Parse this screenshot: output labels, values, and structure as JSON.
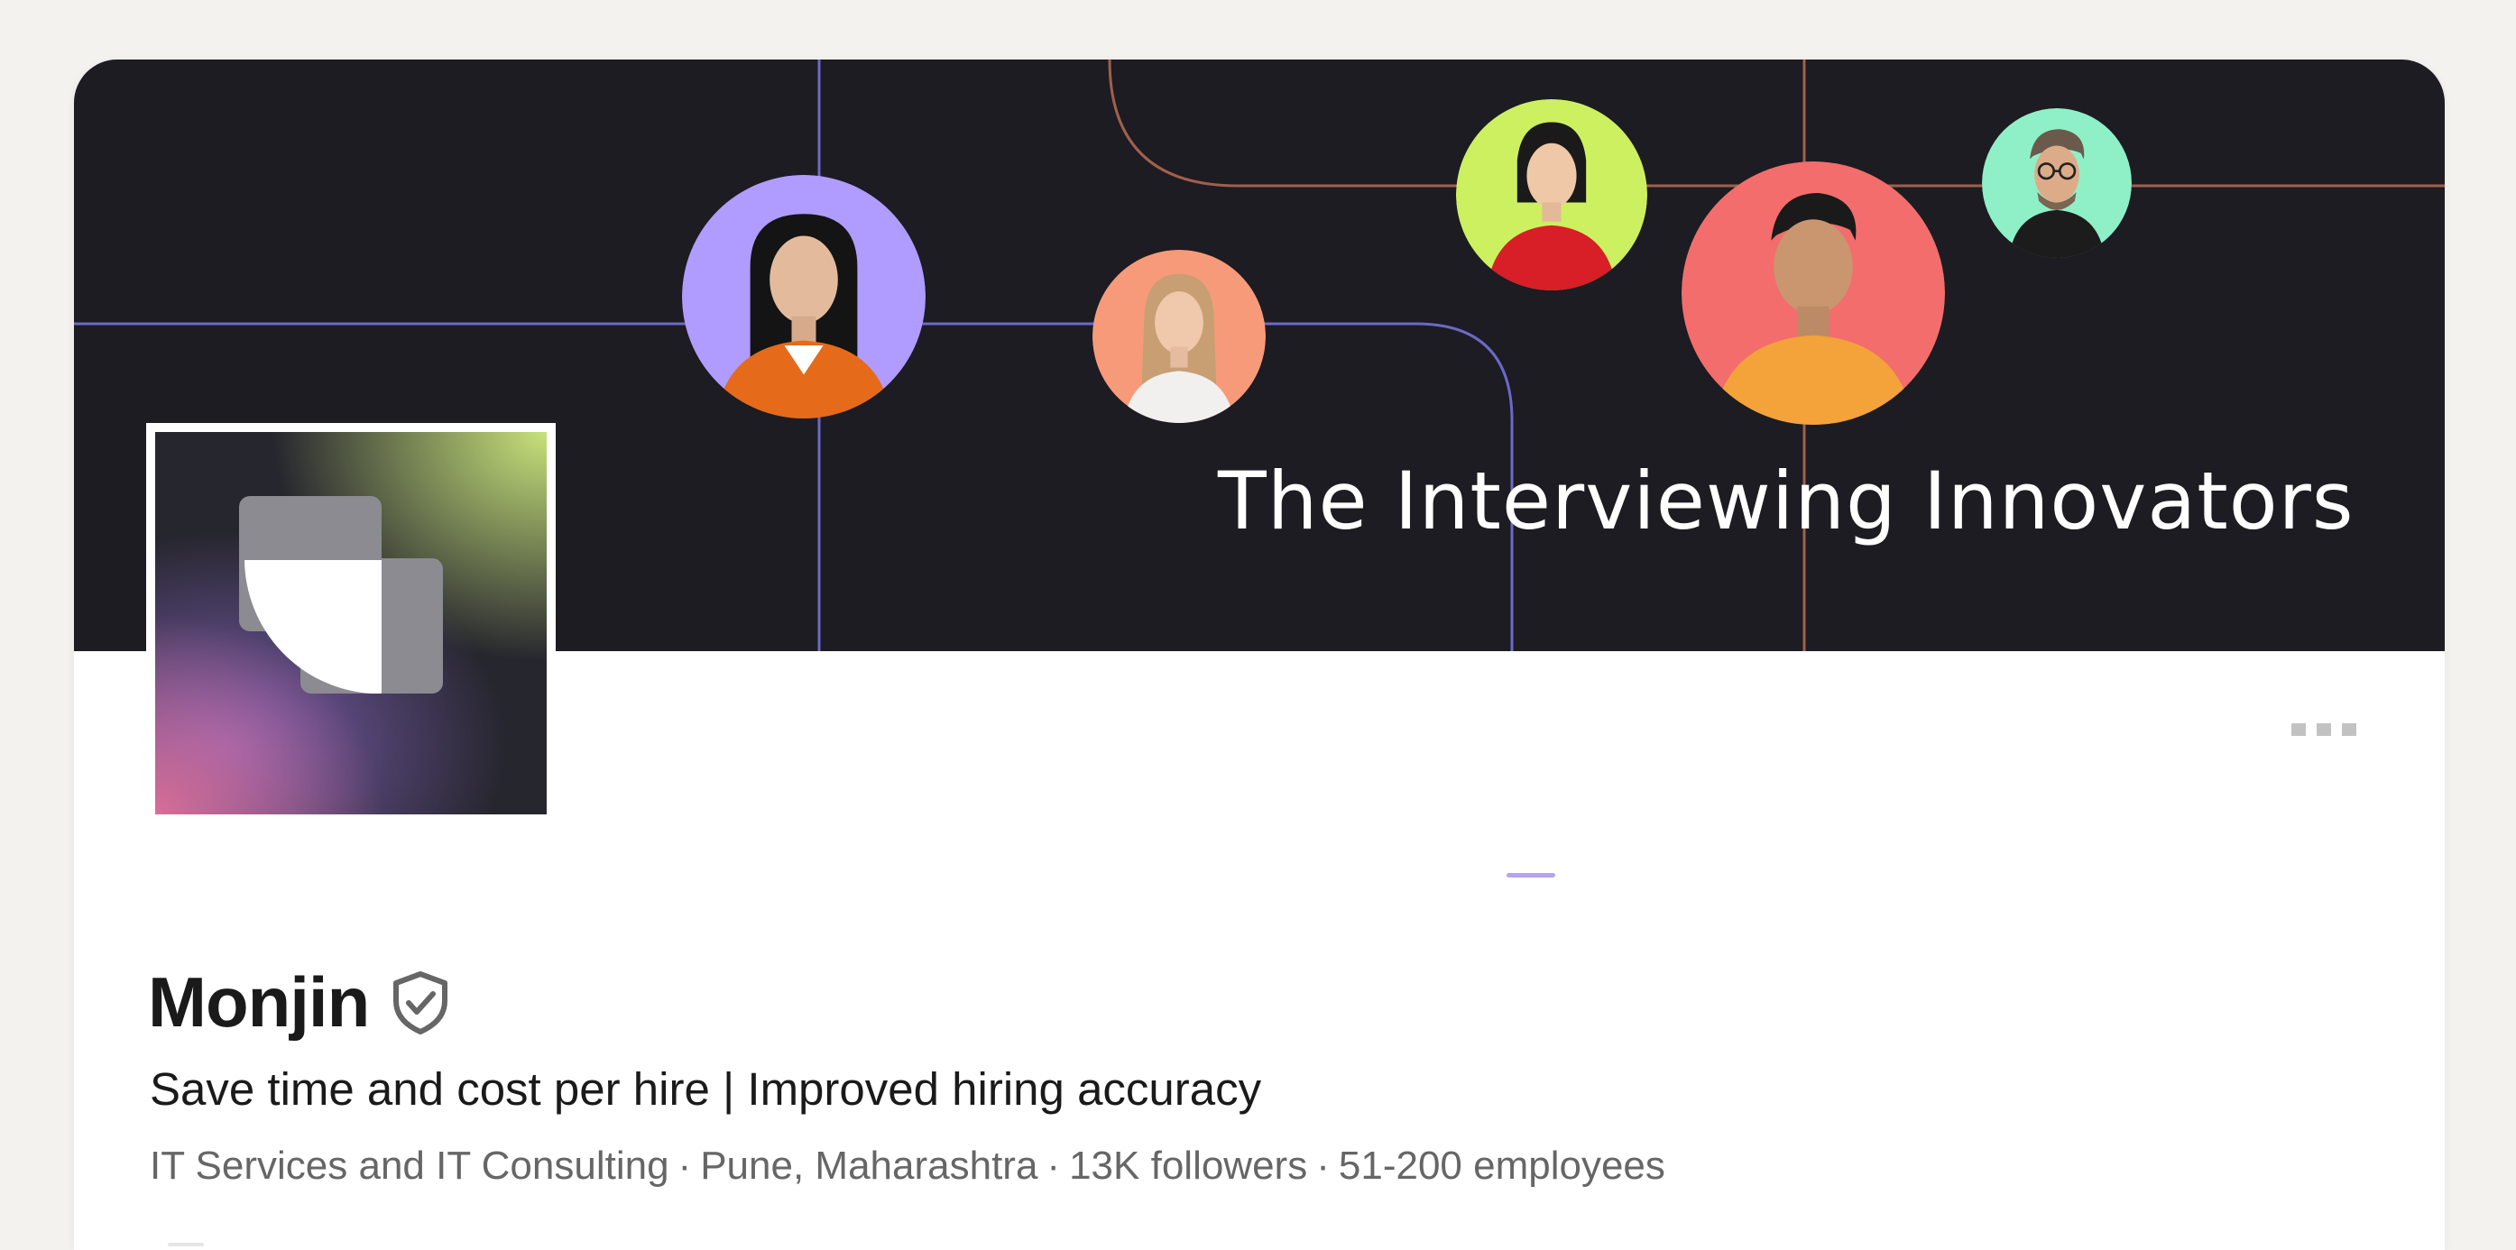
{
  "banner": {
    "title": "The Interviewing Innovators",
    "background_color": "#1c1c22",
    "line_color_purple": "#6d68c8",
    "line_color_orange": "#a0604c",
    "avatars": [
      {
        "name": "woman-orange-jacket",
        "bg": "#b09cff"
      },
      {
        "name": "woman-blonde",
        "bg": "#f79a7a"
      },
      {
        "name": "woman-red-top",
        "bg": "#cdf061"
      },
      {
        "name": "man-orange-sweater",
        "bg": "#f36d6d"
      },
      {
        "name": "man-glasses",
        "bg": "#8ff0c8"
      }
    ]
  },
  "logo": {
    "icon": "monjin-logo-icon"
  },
  "menu": {
    "icon": "more-options-icon"
  },
  "company": {
    "name": "Monjin",
    "verified_icon": "verified-shield-icon",
    "tagline": "Save time and cost per hire | Improved hiring accuracy",
    "industry": "IT Services and IT Consulting",
    "location": "Pune, Maharashtra",
    "followers": "13K followers",
    "employees": "51-200 employees",
    "separator": "·"
  }
}
